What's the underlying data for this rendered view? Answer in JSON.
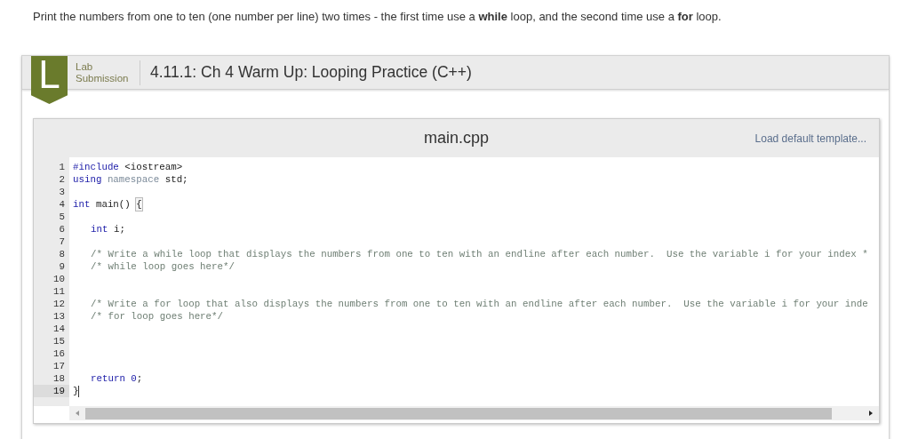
{
  "instructions": "Print the numbers from one to ten (one number per line) two times - the first time use a **while** loop, and the second time use a **for** loop.",
  "lab": {
    "badge": "L",
    "kind_label": "Lab Submission",
    "title": "4.11.1: Ch 4 Warm Up: Looping Practice (C++)"
  },
  "editor": {
    "filename": "main.cpp",
    "template_link": "Load default template...",
    "lines": [
      {
        "number": "1",
        "indented": false,
        "selected": false,
        "tokens": [
          {
            "kind": "keyword",
            "text": "#include"
          },
          {
            "kind": "plain",
            "text": " <iostream>"
          }
        ]
      },
      {
        "number": "2",
        "indented": false,
        "selected": false,
        "tokens": [
          {
            "kind": "keyword",
            "text": "using"
          },
          {
            "kind": "muted",
            "text": " namespace"
          },
          {
            "kind": "plain",
            "text": " std;"
          }
        ]
      },
      {
        "number": "3",
        "selected": false
      },
      {
        "number": "4",
        "indented": false,
        "selected": false,
        "tokens": [
          {
            "kind": "keyword",
            "text": "int"
          },
          {
            "kind": "plain",
            "text": " main() "
          },
          {
            "kind": "brace_match",
            "text": "{"
          }
        ]
      },
      {
        "number": "5",
        "selected": false
      },
      {
        "number": "6",
        "indented": true,
        "selected": false,
        "tokens": [
          {
            "kind": "keyword",
            "text": "int"
          },
          {
            "kind": "plain",
            "text": " i;"
          }
        ]
      },
      {
        "number": "7",
        "selected": false
      },
      {
        "number": "8",
        "indented": true,
        "selected": false,
        "tokens": [
          {
            "kind": "comment",
            "text": "/* Write a while loop that displays the numbers from one to ten with an endline after each number.  Use the variable i for your index *"
          }
        ]
      },
      {
        "number": "9",
        "indented": true,
        "selected": false,
        "tokens": [
          {
            "kind": "comment",
            "text": "/* while loop goes here*/"
          }
        ]
      },
      {
        "number": "10",
        "selected": false
      },
      {
        "number": "11",
        "selected": false
      },
      {
        "number": "12",
        "indented": true,
        "selected": false,
        "tokens": [
          {
            "kind": "comment",
            "text": "/* Write a for loop that also displays the numbers from one to ten with an endline after each number.  Use the variable i for your inde"
          }
        ]
      },
      {
        "number": "13",
        "indented": true,
        "selected": false,
        "tokens": [
          {
            "kind": "comment",
            "text": "/* for loop goes here*/"
          }
        ]
      },
      {
        "number": "14",
        "selected": false
      },
      {
        "number": "15",
        "selected": false
      },
      {
        "number": "16",
        "selected": false
      },
      {
        "number": "17",
        "selected": false
      },
      {
        "number": "18",
        "indented": true,
        "selected": false,
        "tokens": [
          {
            "kind": "keyword",
            "text": "return"
          },
          {
            "kind": "number",
            "text": " 0"
          },
          {
            "kind": "plain",
            "text": ";"
          }
        ]
      },
      {
        "number": "19",
        "indented": false,
        "selected": true,
        "cursor": true,
        "tokens": [
          {
            "kind": "plain",
            "text": "}"
          }
        ]
      }
    ]
  }
}
